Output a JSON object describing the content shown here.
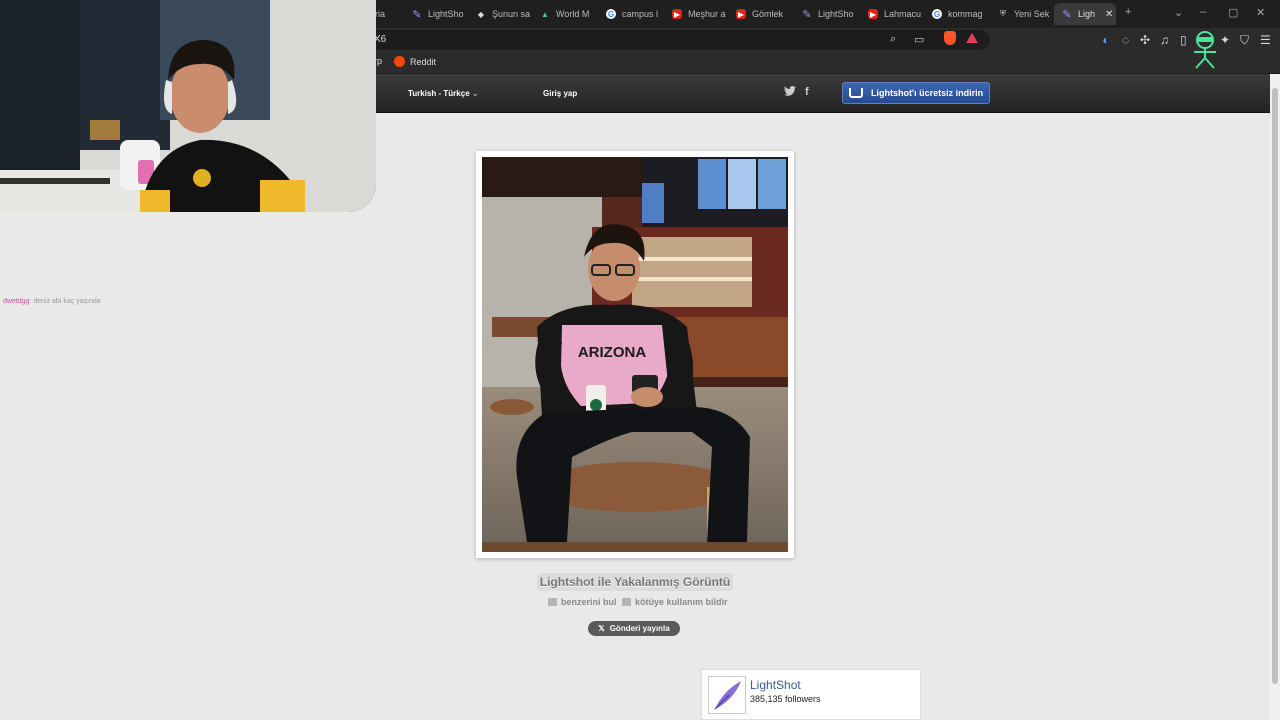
{
  "browser": {
    "tabs": [
      {
        "label": "eria",
        "icon": "none"
      },
      {
        "label": "LightSho",
        "icon": "feather"
      },
      {
        "label": "Şunun sa",
        "icon": "diamond"
      },
      {
        "label": "World M",
        "icon": "wm"
      },
      {
        "label": "campus l",
        "icon": "g"
      },
      {
        "label": "Meşhur a",
        "icon": "yt"
      },
      {
        "label": "Gömlek",
        "icon": "yt"
      },
      {
        "label": "LightSho",
        "icon": "feather"
      },
      {
        "label": "Lahmacu",
        "icon": "yt"
      },
      {
        "label": "kommag",
        "icon": "g"
      },
      {
        "label": "Yeni Sek",
        "icon": "shield"
      },
      {
        "label": "Ligh",
        "icon": "feather",
        "active": true
      }
    ],
    "address_text": "X6",
    "bookmarks": [
      {
        "label": "rp"
      },
      {
        "label": "Reddit"
      }
    ]
  },
  "site": {
    "language": "Turkish - Türkçe",
    "login": "Giriş yap",
    "download_button": "Lightshot'ı ücretsiz indirin"
  },
  "screenshot": {
    "caption": "Lightshot ile Yakalanmış Görüntü",
    "find_similar": "benzerini bul",
    "report_abuse": "kötüye kullanım bildir",
    "tweet_button": "Gönderi yayınla",
    "shirt_text": "ARIZONA"
  },
  "facebook": {
    "page_name": "LightShot",
    "followers": "385,135 followers"
  },
  "stream": {
    "chat_user": "dwetdgg",
    "chat_message": ": deniz abi kaç yaşında"
  },
  "colors": {
    "accent_blue": "#3c67b3",
    "page_bg": "#e9e9e9",
    "header_dark": "#2a2a2a"
  }
}
